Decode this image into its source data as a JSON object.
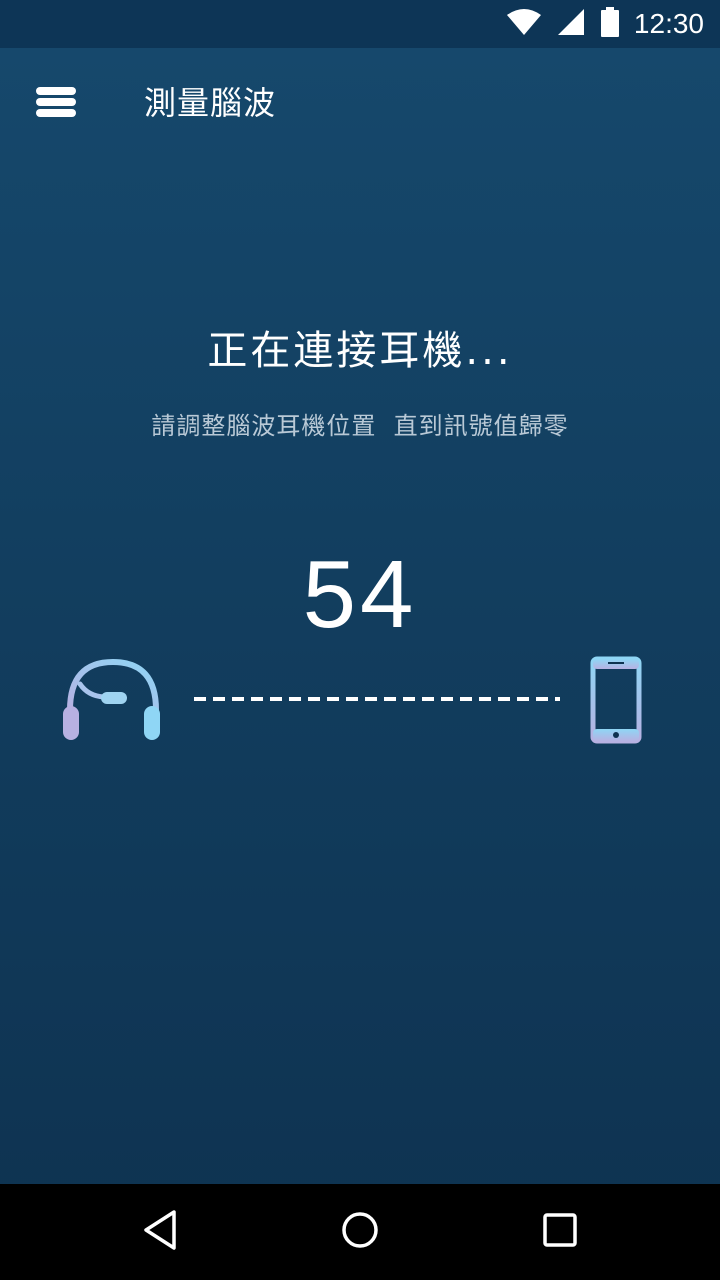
{
  "status_bar": {
    "time": "12:30",
    "icons": [
      "wifi-icon",
      "cell-signal-icon",
      "battery-icon"
    ]
  },
  "toolbar": {
    "menu_icon": "hamburger-menu-icon",
    "title": "測量腦波"
  },
  "connection": {
    "heading": "正在連接耳機...",
    "instruction": "請調整腦波耳機位置  直到訊號值歸零",
    "signal_value": "54",
    "headset_icon": "headset-icon",
    "phone_icon": "smartphone-icon"
  },
  "navigation": {
    "icons": [
      "back-icon",
      "home-icon",
      "recents-icon"
    ]
  },
  "colors": {
    "background_top": "#16496d",
    "background_bottom": "#0e3250",
    "icon_light_blue": "#8fd6f5",
    "icon_lavender": "#b7b1e2"
  }
}
